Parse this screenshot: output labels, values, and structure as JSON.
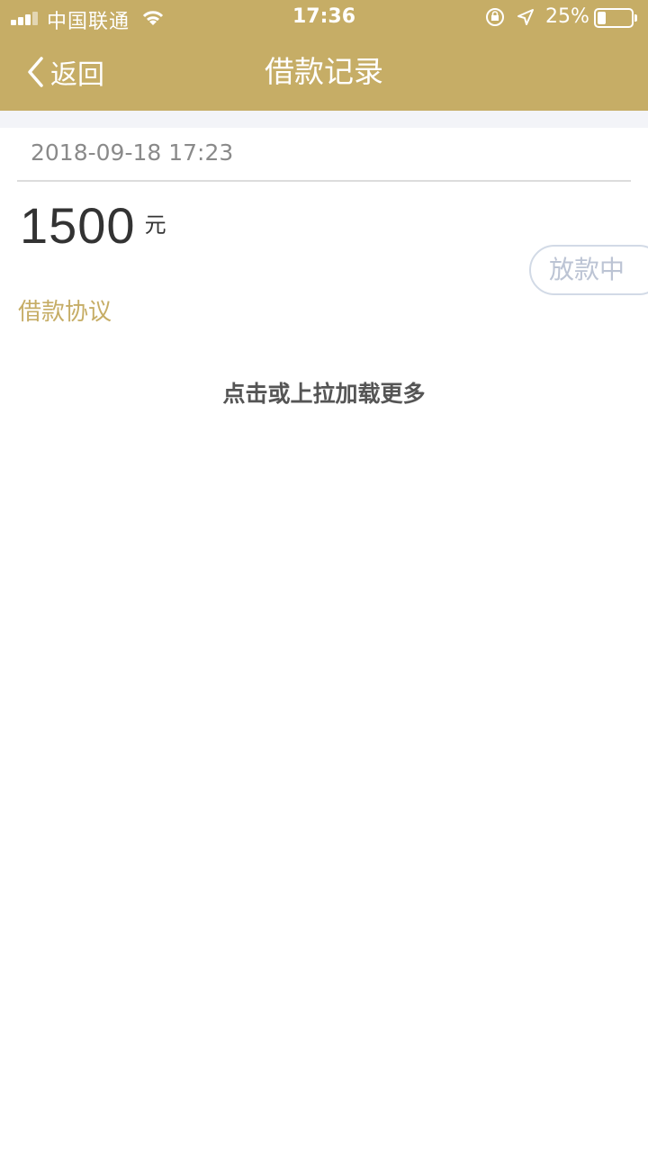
{
  "status_bar": {
    "carrier": "中国联通",
    "time": "17:36",
    "battery_percent": "25%",
    "battery_level": 0.25,
    "icons": [
      "signal-icon",
      "wifi-icon",
      "rotation-lock-icon",
      "location-arrow-icon",
      "battery-icon"
    ]
  },
  "nav": {
    "back_label": "返回",
    "title": "借款记录"
  },
  "record": {
    "date": "2018-09-18 17:23",
    "amount": "1500",
    "unit": "元",
    "status": "放款中",
    "agreement_label": "借款协议"
  },
  "load_more_label": "点击或上拉加载更多",
  "colors": {
    "brand": "#c6ad66",
    "status_pill_border": "#d2dae6",
    "status_pill_text": "#bcc4d4",
    "page_gap": "#f3f4f8"
  }
}
